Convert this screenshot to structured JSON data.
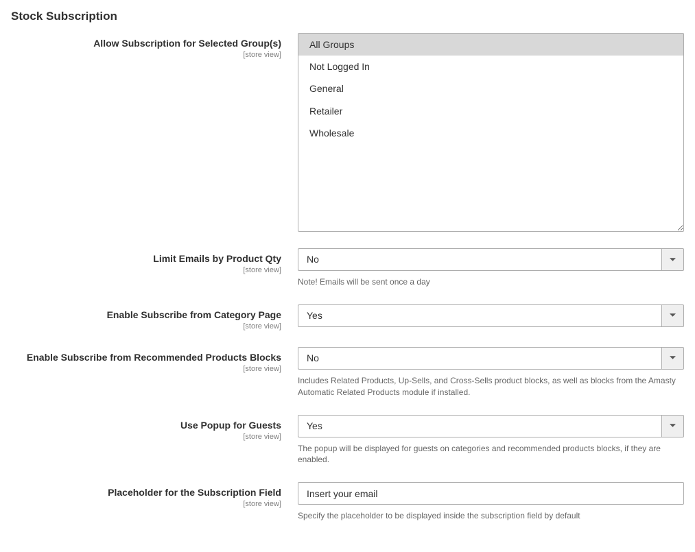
{
  "section_title": "Stock Subscription",
  "scope_label": "[store view]",
  "fields": {
    "allow_groups": {
      "label": "Allow Subscription for Selected Group(s)",
      "options": [
        "All Groups",
        "Not Logged In",
        "General",
        "Retailer",
        "Wholesale"
      ]
    },
    "limit_emails": {
      "label": "Limit Emails by Product Qty",
      "value": "No",
      "note": "Note! Emails will be sent once a day"
    },
    "enable_category": {
      "label": "Enable Subscribe from Category Page",
      "value": "Yes"
    },
    "enable_recommended": {
      "label": "Enable Subscribe from Recommended Products Blocks",
      "value": "No",
      "note": "Includes Related Products, Up-Sells, and Cross-Sells product blocks, as well as blocks from the Amasty Automatic Related Products module if installed."
    },
    "use_popup": {
      "label": "Use Popup for Guests",
      "value": "Yes",
      "note": "The popup will be displayed for guests on categories and recommended products blocks, if they are enabled."
    },
    "placeholder_field": {
      "label": "Placeholder for the Subscription Field",
      "value": "Insert your email",
      "note": "Specify the placeholder to be displayed inside the subscription field by default"
    }
  }
}
